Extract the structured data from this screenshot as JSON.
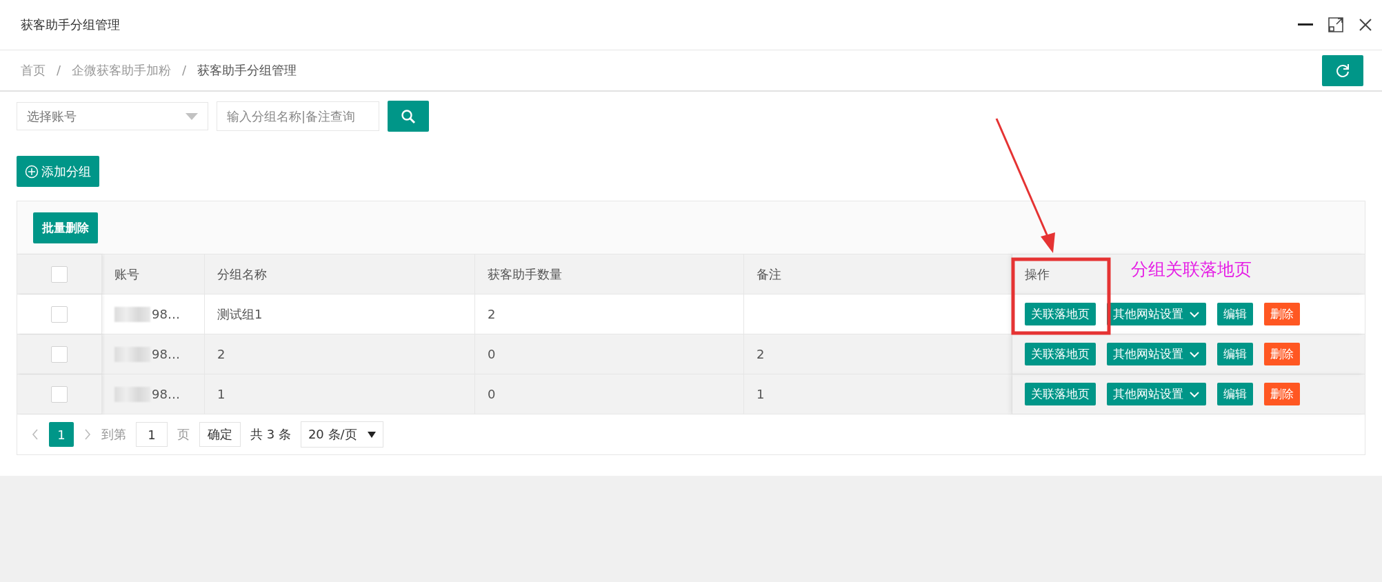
{
  "window": {
    "title": "获客助手分组管理"
  },
  "breadcrumb": {
    "separator": "/",
    "items": [
      {
        "label": "首页",
        "current": false
      },
      {
        "label": "企微获客助手加粉",
        "current": false
      },
      {
        "label": "获客助手分组管理",
        "current": true
      }
    ]
  },
  "filters": {
    "account_select": {
      "placeholder": "选择账号"
    },
    "search": {
      "placeholder": "输入分组名称|备注查询"
    }
  },
  "add_button": "添加分组",
  "batch_delete_button": "批量删除",
  "table": {
    "header_checked": false,
    "columns": [
      "账号",
      "分组名称",
      "获客助手数量",
      "备注",
      "操作"
    ],
    "rows": [
      {
        "checked": false,
        "highlighted": true,
        "account": "98…",
        "group_name": "测试组1",
        "count": "2",
        "actions": [
          {
            "kind": "primary",
            "label": "关联落地页"
          },
          {
            "kind": "dropdown",
            "label": "其他网站设置"
          },
          {
            "kind": "primary",
            "label": "编辑"
          },
          {
            "kind": "danger",
            "label": "删除"
          }
        ]
      },
      {
        "checked": false,
        "highlighted": false,
        "account": "98…",
        "group_name": "2",
        "count": "0",
        "remark": "2",
        "actions": [
          {
            "kind": "primary",
            "label": "关联落地页"
          },
          {
            "kind": "dropdown",
            "label": "其他网站设置"
          },
          {
            "kind": "primary",
            "label": "编辑"
          },
          {
            "kind": "danger",
            "label": "删除"
          }
        ]
      },
      {
        "checked": false,
        "highlighted": false,
        "account": "98…",
        "group_name": "1",
        "count": "0",
        "remark": "1",
        "actions": [
          {
            "kind": "primary",
            "label": "关联落地页"
          },
          {
            "kind": "dropdown",
            "label": "其他网站设置"
          },
          {
            "kind": "primary",
            "label": "编辑"
          },
          {
            "kind": "danger",
            "label": "删除"
          }
        ]
      }
    ]
  },
  "pagination": {
    "pages": [
      {
        "label": "1",
        "selected": true
      }
    ],
    "goto_label": "到第",
    "goto_value": "1",
    "page_unit": "页",
    "confirm": "确定",
    "total": "共 3 条",
    "page_size": "20 条/页"
  },
  "annotation": {
    "text": "分组关联落地页"
  }
}
